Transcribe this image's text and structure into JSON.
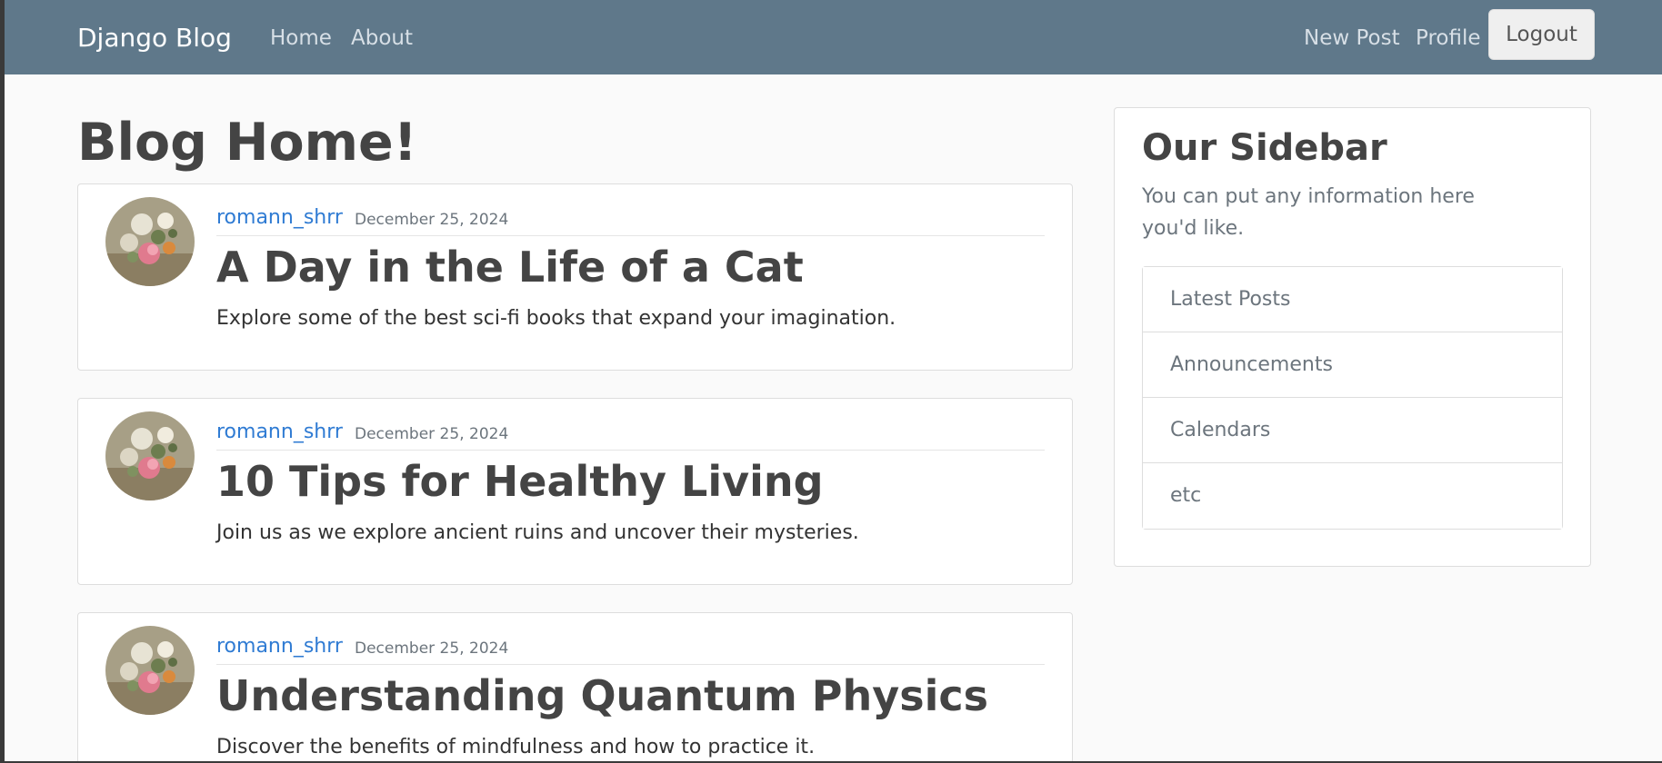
{
  "navbar": {
    "brand": "Django Blog",
    "links": {
      "home": "Home",
      "about": "About",
      "new_post": "New Post",
      "profile": "Profile",
      "logout": "Logout"
    }
  },
  "main": {
    "title": "Blog Home!",
    "posts": [
      {
        "author": "romann_shrr",
        "date": "December 25, 2024",
        "title": "A Day in the Life of a Cat",
        "content": "Explore some of the best sci-fi books that expand your imagination."
      },
      {
        "author": "romann_shrr",
        "date": "December 25, 2024",
        "title": "10 Tips for Healthy Living",
        "content": "Join us as we explore ancient ruins and uncover their mysteries."
      },
      {
        "author": "romann_shrr",
        "date": "December 25, 2024",
        "title": "Understanding Quantum Physics",
        "content": "Discover the benefits of mindfulness and how to practice it."
      }
    ]
  },
  "sidebar": {
    "title": "Our Sidebar",
    "text": "You can put any information here you'd like.",
    "items": [
      "Latest Posts",
      "Announcements",
      "Calendars",
      "etc"
    ]
  },
  "colors": {
    "navbar": "#5f788a",
    "background": "#fafafa",
    "link": "#2f7bd3",
    "muted": "#6c757d"
  },
  "icons": {
    "avatar": "profile-picture-flowers"
  }
}
